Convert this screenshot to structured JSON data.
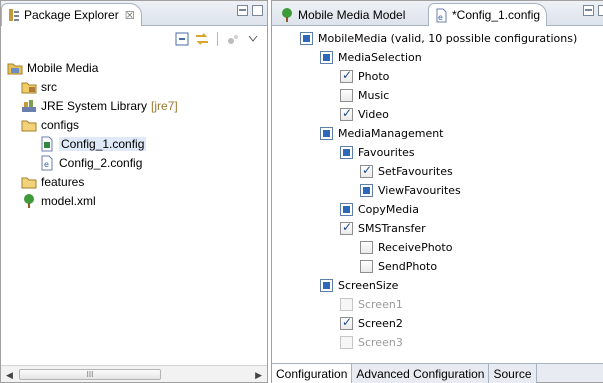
{
  "package_explorer": {
    "tab_title": "Package Explorer",
    "tab_close": "☒",
    "tree": [
      {
        "label": "Mobile Media",
        "icon": "project-icon",
        "deco": ""
      },
      {
        "label": "src",
        "icon": "source-folder-icon",
        "deco": ""
      },
      {
        "label": "JRE System Library",
        "icon": "library-icon",
        "deco": "[jre7]"
      },
      {
        "label": "configs",
        "icon": "folder-icon",
        "deco": ""
      },
      {
        "label": "Config_1.config",
        "icon": "config-file-icon",
        "deco": "",
        "selected": true
      },
      {
        "label": "Config_2.config",
        "icon": "config-file-icon",
        "deco": ""
      },
      {
        "label": "features",
        "icon": "folder-icon",
        "deco": ""
      },
      {
        "label": "model.xml",
        "icon": "feature-model-icon",
        "deco": ""
      }
    ],
    "scroll_thumb_grip": "III"
  },
  "editor": {
    "tabs": [
      {
        "label": "Mobile Media Model",
        "icon": "feature-model-icon",
        "active": false
      },
      {
        "label": "*Config_1.config",
        "icon": "config-file-icon",
        "active": true
      }
    ],
    "features": [
      {
        "label": "MobileMedia (valid, 10 possible configurations)",
        "kind": "feature",
        "state": "selected",
        "indent": 0
      },
      {
        "label": "MediaSelection",
        "kind": "feature",
        "state": "selected",
        "indent": 1
      },
      {
        "label": "Photo",
        "kind": "checkbox",
        "state": "checked",
        "indent": 2
      },
      {
        "label": "Music",
        "kind": "checkbox",
        "state": "unchecked",
        "indent": 2
      },
      {
        "label": "Video",
        "kind": "checkbox",
        "state": "checked",
        "indent": 2
      },
      {
        "label": "MediaManagement",
        "kind": "feature",
        "state": "selected",
        "indent": 1
      },
      {
        "label": "Favourites",
        "kind": "feature",
        "state": "selected",
        "indent": 2
      },
      {
        "label": "SetFavourites",
        "kind": "checkbox",
        "state": "checked",
        "indent": 3
      },
      {
        "label": "ViewFavourites",
        "kind": "feature",
        "state": "selected",
        "indent": 3
      },
      {
        "label": "CopyMedia",
        "kind": "feature",
        "state": "selected",
        "indent": 2
      },
      {
        "label": "SMSTransfer",
        "kind": "checkbox",
        "state": "checked",
        "indent": 2
      },
      {
        "label": "ReceivePhoto",
        "kind": "checkbox",
        "state": "unchecked",
        "indent": 3
      },
      {
        "label": "SendPhoto",
        "kind": "checkbox",
        "state": "unchecked",
        "indent": 3
      },
      {
        "label": "ScreenSize",
        "kind": "feature",
        "state": "selected",
        "indent": 1
      },
      {
        "label": "Screen1",
        "kind": "checkbox",
        "state": "disabled",
        "indent": 2
      },
      {
        "label": "Screen2",
        "kind": "checkbox",
        "state": "checked",
        "indent": 2
      },
      {
        "label": "Screen3",
        "kind": "checkbox",
        "state": "disabled",
        "indent": 2
      }
    ],
    "bottom_tabs": [
      {
        "label": "Configuration",
        "active": true
      },
      {
        "label": "Advanced Configuration",
        "active": false
      },
      {
        "label": "Source",
        "active": false
      }
    ]
  },
  "colors": {
    "feature_blue": "#2e68b8",
    "selection_bg": "#dfe9f7",
    "decoration_text": "#9c7a32",
    "disabled_text": "#9a9a9a"
  }
}
